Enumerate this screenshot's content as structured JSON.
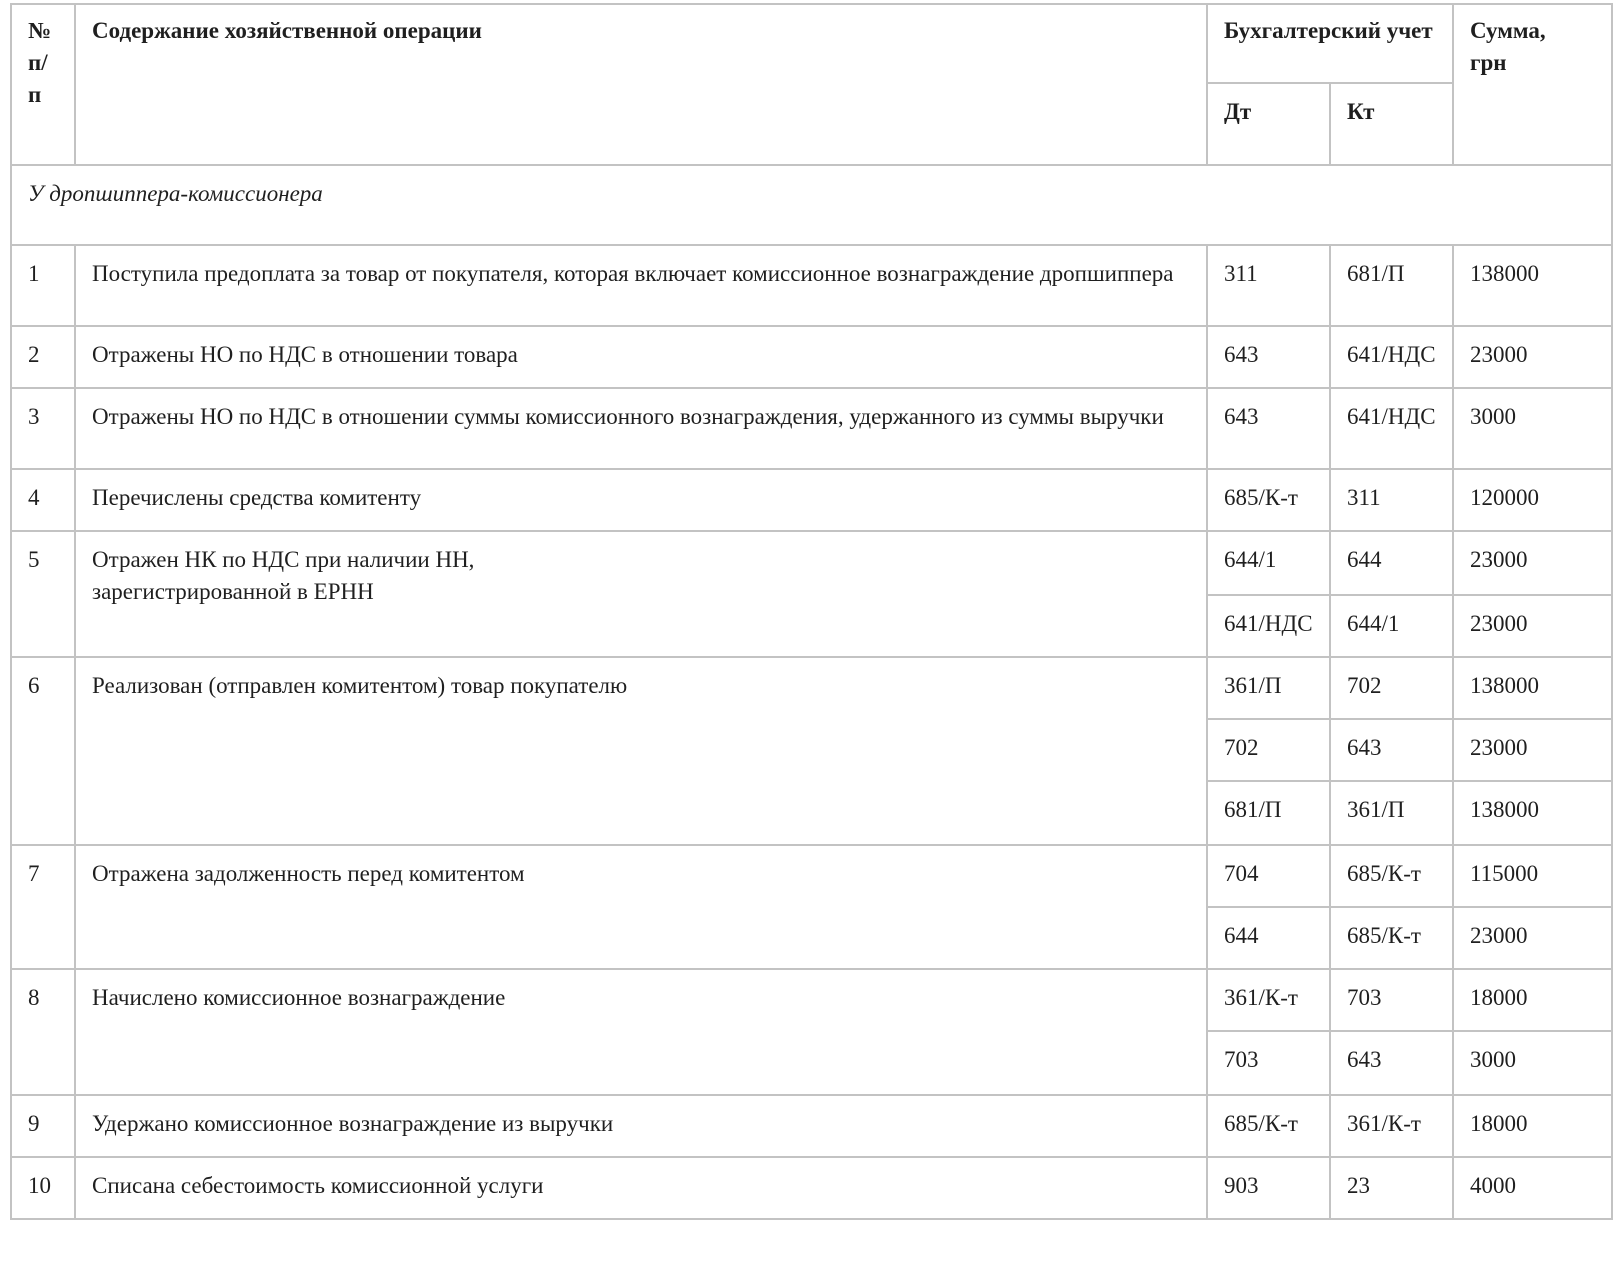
{
  "header": {
    "num_line1": "№",
    "num_line2": "п/п",
    "content": "Содержание хозяйственной операции",
    "accounting": "Бухгалтерский учет",
    "debit": "Дт",
    "credit": "Кт",
    "sum_line1": "Сумма,",
    "sum_line2": "грн"
  },
  "section": {
    "title": "У дропшиппера-комиссионера"
  },
  "rows": [
    {
      "num": "1",
      "description": "Поступила предоплата за товар от покупателя, которая включает комиссионное вознаграждение дропшиппера",
      "entries": [
        {
          "dt": "311",
          "kt": "681/П",
          "sum": "138000"
        }
      ]
    },
    {
      "num": "2",
      "description": "Отражены НО по НДС в отношении товара",
      "entries": [
        {
          "dt": "643",
          "kt": "641/НДС",
          "sum": "23000"
        }
      ]
    },
    {
      "num": "3",
      "description": "Отражены НО по НДС в отношении суммы комиссионного вознаграждения, удержанного из суммы выручки",
      "entries": [
        {
          "dt": "643",
          "kt": "641/НДС",
          "sum": "3000"
        }
      ]
    },
    {
      "num": "4",
      "description": "Перечислены средства комитенту",
      "entries": [
        {
          "dt": "685/К-т",
          "kt": "311",
          "sum": "120000"
        }
      ]
    },
    {
      "num": "5",
      "description_line1": "Отражен НК по НДС при наличии НН,",
      "description_line2": "зарегистрированной в ЕРНН",
      "entries": [
        {
          "dt": "644/1",
          "kt": "644",
          "sum": "23000"
        },
        {
          "dt": "641/НДС",
          "kt": "644/1",
          "sum": "23000"
        }
      ]
    },
    {
      "num": "6",
      "description": "Реализован (отправлен комитентом) товар покупателю",
      "entries": [
        {
          "dt": "361/П",
          "kt": "702",
          "sum": "138000"
        },
        {
          "dt": "702",
          "kt": "643",
          "sum": "23000"
        },
        {
          "dt": "681/П",
          "kt": "361/П",
          "sum": "138000"
        }
      ]
    },
    {
      "num": "7",
      "description": "Отражена задолженность перед комитентом",
      "entries": [
        {
          "dt": "704",
          "kt": "685/К-т",
          "sum": "115000"
        },
        {
          "dt": "644",
          "kt": "685/К-т",
          "sum": "23000"
        }
      ]
    },
    {
      "num": "8",
      "description": "Начислено комиссионное вознаграждение",
      "entries": [
        {
          "dt": "361/К-т",
          "kt": "703",
          "sum": "18000"
        },
        {
          "dt": "703",
          "kt": "643",
          "sum": "3000"
        }
      ]
    },
    {
      "num": "9",
      "description": "Удержано комиссионное вознаграждение из выручки",
      "entries": [
        {
          "dt": "685/К-т",
          "kt": "361/К-т",
          "sum": "18000"
        }
      ]
    },
    {
      "num": "10",
      "description": "Списана себестоимость комиссионной услуги",
      "entries": [
        {
          "dt": "903",
          "kt": "23",
          "sum": "4000"
        }
      ]
    }
  ]
}
